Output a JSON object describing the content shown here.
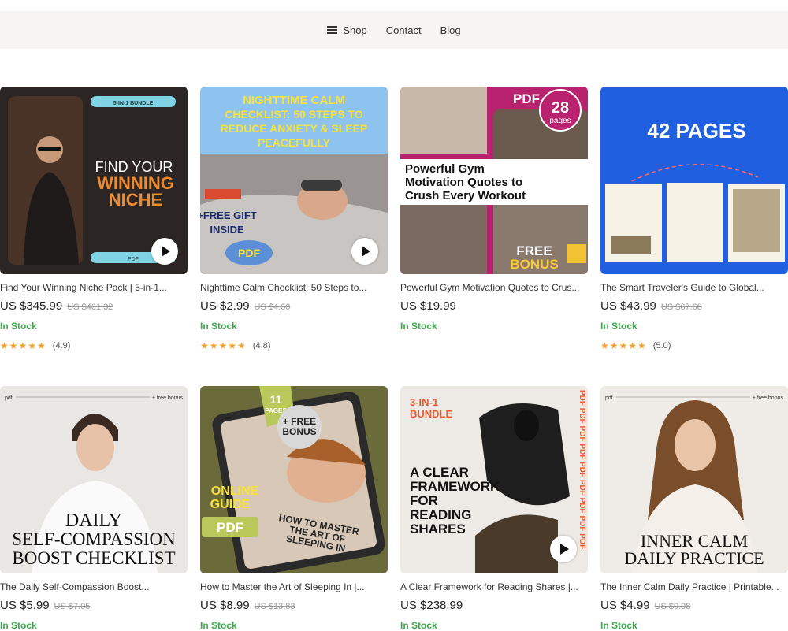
{
  "nav": {
    "items": [
      "Shop",
      "Contact",
      "Blog"
    ]
  },
  "products": [
    {
      "image_text": [
        "5-IN-1 BUNDLE",
        "FIND YOUR",
        "WINNING",
        "NICHE",
        "PDF"
      ],
      "title": "Find Your Winning Niche Pack | 5-in-1...",
      "price": "US $345.99",
      "old_price": "US $461.32",
      "stock": "In Stock",
      "stars": "★★★★★",
      "rating": "(4.9)"
    },
    {
      "image_text": [
        "NIGHTTIME CALM",
        "CHECKLIST: 50 STEPS TO",
        "REDUCE ANXIETY & SLEEP",
        "PEACEFULLY",
        "+FREE GIFT",
        "INSIDE",
        "PDF"
      ],
      "title": "Nighttime Calm Checklist: 50 Steps to...",
      "price": "US $2.99",
      "old_price": "US $4.60",
      "stock": "In Stock",
      "stars": "★★★★★",
      "rating": "(4.8)"
    },
    {
      "image_text": [
        "PDF",
        "28",
        "pages",
        "Powerful Gym",
        "Motivation Quotes to",
        "Crush Every Workout",
        "FREE",
        "BONUS"
      ],
      "title": "Powerful Gym Motivation Quotes to Crus...",
      "price": "US $19.99",
      "old_price": "",
      "stock": "In Stock",
      "stars": "",
      "rating": ""
    },
    {
      "image_text": [
        "42 PAGES"
      ],
      "title": "The Smart Traveler's Guide to Global...",
      "price": "US $43.99",
      "old_price": "US $67.68",
      "stock": "In Stock",
      "stars": "★★★★★",
      "rating": "(5.0)"
    },
    {
      "image_text": [
        "pdf",
        "+ free bonus",
        "DAILY",
        "SELF-COMPASSION",
        "BOOST CHECKLIST"
      ],
      "title": "The Daily Self-Compassion Boost...",
      "price": "US $5.99",
      "old_price": "US $7.05",
      "stock": "In Stock",
      "stars": "",
      "rating": ""
    },
    {
      "image_text": [
        "11",
        "PAGES",
        "+ FREE",
        "BONUS",
        "ONLINE",
        "GUIDE",
        "PDF",
        "HOW TO MASTER",
        "THE ART OF",
        "SLEEPING IN"
      ],
      "title": "How to Master the Art of Sleeping In |...",
      "price": "US $8.99",
      "old_price": "US $13.83",
      "stock": "In Stock",
      "stars": "",
      "rating": ""
    },
    {
      "image_text": [
        "3-IN-1",
        "BUNDLE",
        "A CLEAR",
        "FRAMEWORK",
        "FOR",
        "READING",
        "SHARES",
        "PDF PDF PDF PDF PDF PDF PDF PDF PDF"
      ],
      "title": "A Clear Framework for Reading Shares |...",
      "price": "US $238.99",
      "old_price": "",
      "stock": "In Stock",
      "stars": "",
      "rating": ""
    },
    {
      "image_text": [
        "pdf",
        "+ free bonus",
        "INNER CALM",
        "DAILY PRACTICE"
      ],
      "title": "The Inner Calm Daily Practice | Printable...",
      "price": "US $4.99",
      "old_price": "US $9.98",
      "stock": "In Stock",
      "stars": "",
      "rating": ""
    }
  ]
}
